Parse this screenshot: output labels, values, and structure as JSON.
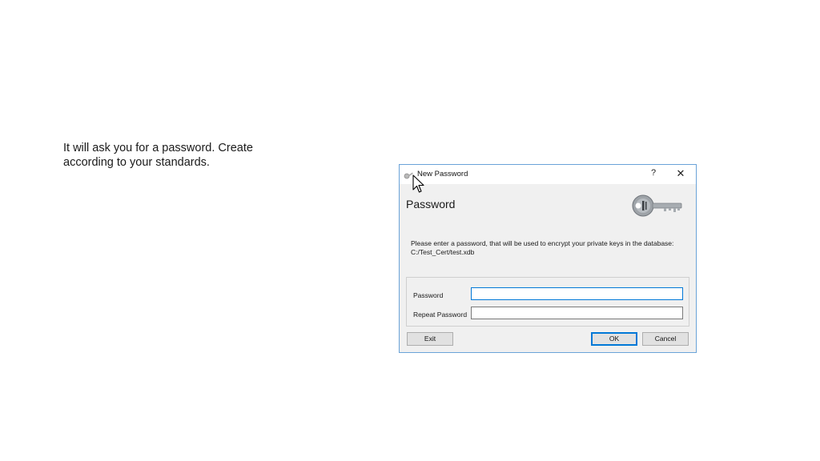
{
  "caption": {
    "line1": "It will ask you for a password. Create",
    "line2": "according to your standards."
  },
  "dialog": {
    "title": "New Password",
    "help_label": "?",
    "close_label": "✕",
    "heading": "Password",
    "description_line1": "Please enter a password, that will be used to encrypt your private keys in the database:",
    "description_line2": "C:/Test_Cert/test.xdb",
    "fields": [
      {
        "label": "Password",
        "value": ""
      },
      {
        "label": "Repeat Password",
        "value": ""
      }
    ],
    "buttons": {
      "exit": "Exit",
      "ok": "OK",
      "cancel": "Cancel"
    }
  },
  "colors": {
    "dialog_bg": "#f0f0f0",
    "accent": "#0078d7",
    "button_bg": "#e1e1e1"
  },
  "icons": {
    "app": "key-icon",
    "header": "key-icon",
    "cursor": "arrow-cursor-icon"
  }
}
